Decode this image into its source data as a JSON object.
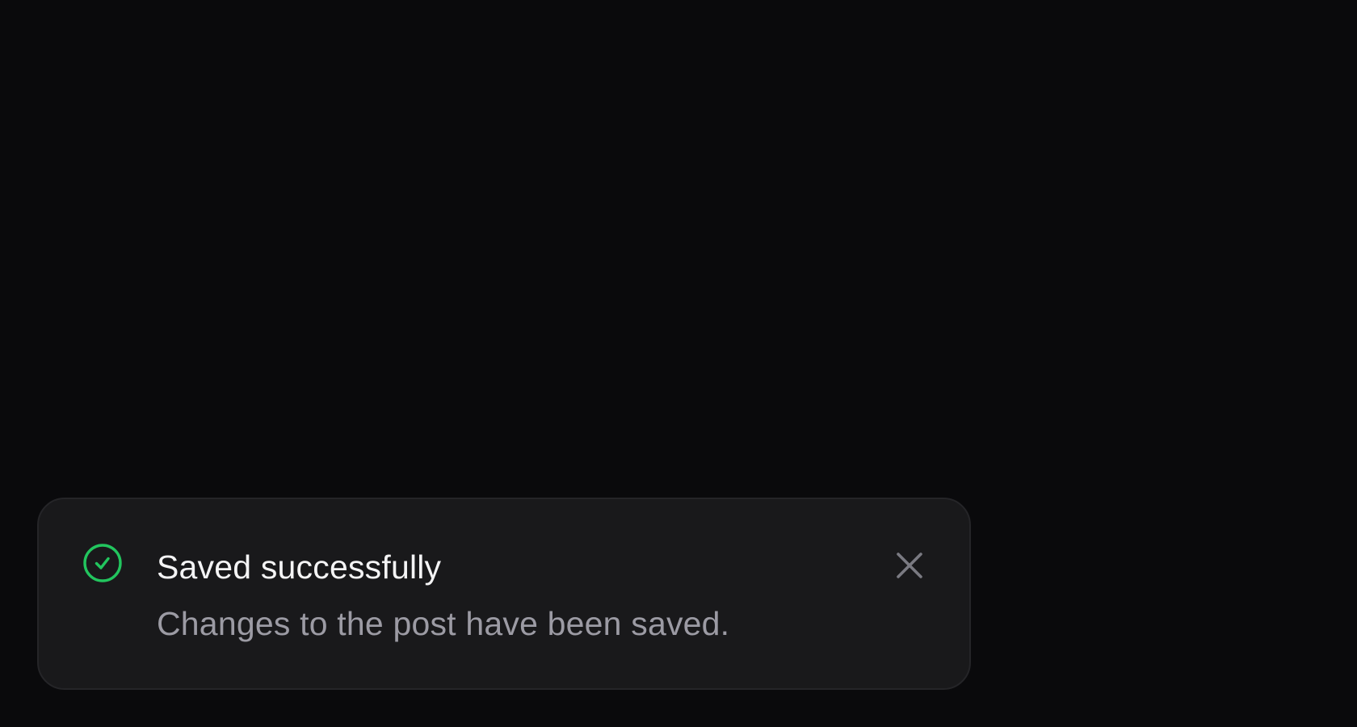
{
  "toast": {
    "status": "success",
    "title": "Saved successfully",
    "message": "Changes to the post have been saved.",
    "icon": "check-circle-icon",
    "close_icon": "close-icon",
    "colors": {
      "background": "#0a0a0c",
      "panel": "#19191b",
      "panel_border": "#252528",
      "title": "#f4f4f5",
      "message": "#9c9ba4",
      "success": "#22c55e",
      "close": "#7a7a82"
    }
  }
}
